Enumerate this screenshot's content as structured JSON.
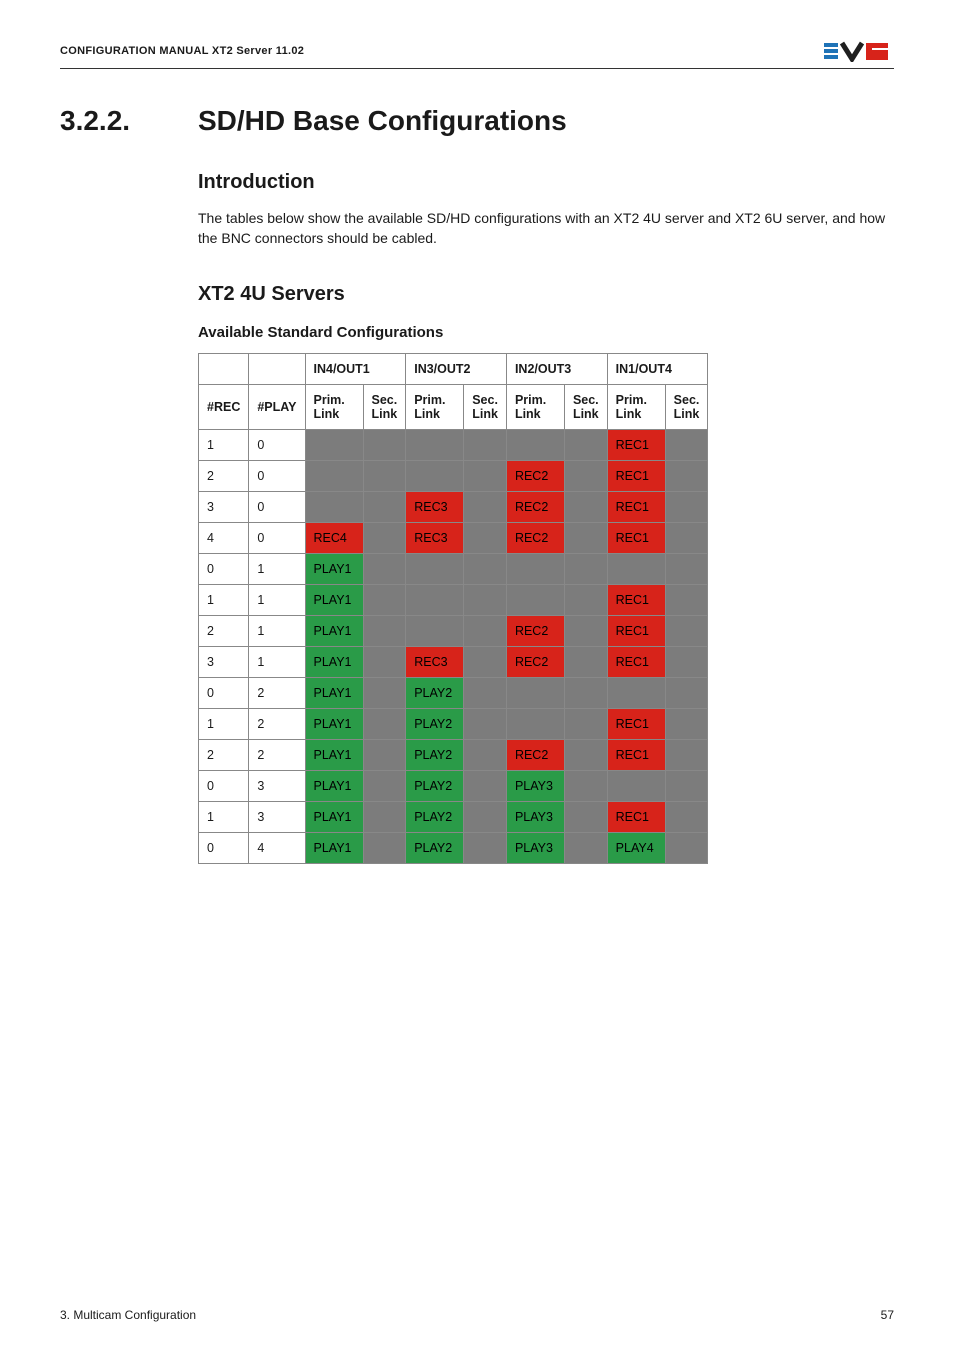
{
  "header": {
    "manual_title": "CONFIGURATION MANUAL XT2 Server 11.02"
  },
  "section": {
    "number": "3.2.2.",
    "title": "SD/HD Base Configurations"
  },
  "intro": {
    "heading": "Introduction",
    "text": "The tables below show the available SD/HD configurations with an XT2 4U server and XT2 6U server, and how the BNC connectors should be cabled."
  },
  "servers_heading": "XT2 4U Servers",
  "table_heading": "Available Standard Configurations",
  "columns": {
    "group_labels": [
      "IN4/OUT1",
      "IN3/OUT2",
      "IN2/OUT3",
      "IN1/OUT4"
    ],
    "rec": "#REC",
    "play": "#PLAY",
    "prim": "Prim. Link",
    "sec": "Sec. Link"
  },
  "chart_data": {
    "type": "table",
    "title": "Available Standard Configurations",
    "columns": [
      "#REC",
      "#PLAY",
      "IN4/OUT1 Prim. Link",
      "IN4/OUT1 Sec. Link",
      "IN3/OUT2 Prim. Link",
      "IN3/OUT2 Sec. Link",
      "IN2/OUT3 Prim. Link",
      "IN2/OUT3 Sec. Link",
      "IN1/OUT4 Prim. Link",
      "IN1/OUT4 Sec. Link"
    ],
    "rows": [
      {
        "rec": "1",
        "play": "0",
        "cells": [
          {
            "v": "",
            "t": "gray"
          },
          {
            "v": "",
            "t": "gray"
          },
          {
            "v": "",
            "t": "gray"
          },
          {
            "v": "",
            "t": "gray"
          },
          {
            "v": "",
            "t": "gray"
          },
          {
            "v": "",
            "t": "gray"
          },
          {
            "v": "REC1",
            "t": "rec"
          },
          {
            "v": "",
            "t": "gray"
          }
        ]
      },
      {
        "rec": "2",
        "play": "0",
        "cells": [
          {
            "v": "",
            "t": "gray"
          },
          {
            "v": "",
            "t": "gray"
          },
          {
            "v": "",
            "t": "gray"
          },
          {
            "v": "",
            "t": "gray"
          },
          {
            "v": "REC2",
            "t": "rec"
          },
          {
            "v": "",
            "t": "gray"
          },
          {
            "v": "REC1",
            "t": "rec"
          },
          {
            "v": "",
            "t": "gray"
          }
        ]
      },
      {
        "rec": "3",
        "play": "0",
        "cells": [
          {
            "v": "",
            "t": "gray"
          },
          {
            "v": "",
            "t": "gray"
          },
          {
            "v": "REC3",
            "t": "rec"
          },
          {
            "v": "",
            "t": "gray"
          },
          {
            "v": "REC2",
            "t": "rec"
          },
          {
            "v": "",
            "t": "gray"
          },
          {
            "v": "REC1",
            "t": "rec"
          },
          {
            "v": "",
            "t": "gray"
          }
        ]
      },
      {
        "rec": "4",
        "play": "0",
        "cells": [
          {
            "v": "REC4",
            "t": "rec"
          },
          {
            "v": "",
            "t": "gray"
          },
          {
            "v": "REC3",
            "t": "rec"
          },
          {
            "v": "",
            "t": "gray"
          },
          {
            "v": "REC2",
            "t": "rec"
          },
          {
            "v": "",
            "t": "gray"
          },
          {
            "v": "REC1",
            "t": "rec"
          },
          {
            "v": "",
            "t": "gray"
          }
        ]
      },
      {
        "rec": "0",
        "play": "1",
        "cells": [
          {
            "v": "PLAY1",
            "t": "play"
          },
          {
            "v": "",
            "t": "gray"
          },
          {
            "v": "",
            "t": "gray"
          },
          {
            "v": "",
            "t": "gray"
          },
          {
            "v": "",
            "t": "gray"
          },
          {
            "v": "",
            "t": "gray"
          },
          {
            "v": "",
            "t": "gray"
          },
          {
            "v": "",
            "t": "gray"
          }
        ]
      },
      {
        "rec": "1",
        "play": "1",
        "cells": [
          {
            "v": "PLAY1",
            "t": "play"
          },
          {
            "v": "",
            "t": "gray"
          },
          {
            "v": "",
            "t": "gray"
          },
          {
            "v": "",
            "t": "gray"
          },
          {
            "v": "",
            "t": "gray"
          },
          {
            "v": "",
            "t": "gray"
          },
          {
            "v": "REC1",
            "t": "rec"
          },
          {
            "v": "",
            "t": "gray"
          }
        ]
      },
      {
        "rec": "2",
        "play": "1",
        "cells": [
          {
            "v": "PLAY1",
            "t": "play"
          },
          {
            "v": "",
            "t": "gray"
          },
          {
            "v": "",
            "t": "gray"
          },
          {
            "v": "",
            "t": "gray"
          },
          {
            "v": "REC2",
            "t": "rec"
          },
          {
            "v": "",
            "t": "gray"
          },
          {
            "v": "REC1",
            "t": "rec"
          },
          {
            "v": "",
            "t": "gray"
          }
        ]
      },
      {
        "rec": "3",
        "play": "1",
        "cells": [
          {
            "v": "PLAY1",
            "t": "play"
          },
          {
            "v": "",
            "t": "gray"
          },
          {
            "v": "REC3",
            "t": "rec"
          },
          {
            "v": "",
            "t": "gray"
          },
          {
            "v": "REC2",
            "t": "rec"
          },
          {
            "v": "",
            "t": "gray"
          },
          {
            "v": "REC1",
            "t": "rec"
          },
          {
            "v": "",
            "t": "gray"
          }
        ]
      },
      {
        "rec": "0",
        "play": "2",
        "cells": [
          {
            "v": "PLAY1",
            "t": "play"
          },
          {
            "v": "",
            "t": "gray"
          },
          {
            "v": "PLAY2",
            "t": "play"
          },
          {
            "v": "",
            "t": "gray"
          },
          {
            "v": "",
            "t": "gray"
          },
          {
            "v": "",
            "t": "gray"
          },
          {
            "v": "",
            "t": "gray"
          },
          {
            "v": "",
            "t": "gray"
          }
        ]
      },
      {
        "rec": "1",
        "play": "2",
        "cells": [
          {
            "v": "PLAY1",
            "t": "play"
          },
          {
            "v": "",
            "t": "gray"
          },
          {
            "v": "PLAY2",
            "t": "play"
          },
          {
            "v": "",
            "t": "gray"
          },
          {
            "v": "",
            "t": "gray"
          },
          {
            "v": "",
            "t": "gray"
          },
          {
            "v": "REC1",
            "t": "rec"
          },
          {
            "v": "",
            "t": "gray"
          }
        ]
      },
      {
        "rec": "2",
        "play": "2",
        "cells": [
          {
            "v": "PLAY1",
            "t": "play"
          },
          {
            "v": "",
            "t": "gray"
          },
          {
            "v": "PLAY2",
            "t": "play"
          },
          {
            "v": "",
            "t": "gray"
          },
          {
            "v": "REC2",
            "t": "rec"
          },
          {
            "v": "",
            "t": "gray"
          },
          {
            "v": "REC1",
            "t": "rec"
          },
          {
            "v": "",
            "t": "gray"
          }
        ]
      },
      {
        "rec": "0",
        "play": "3",
        "cells": [
          {
            "v": "PLAY1",
            "t": "play"
          },
          {
            "v": "",
            "t": "gray"
          },
          {
            "v": "PLAY2",
            "t": "play"
          },
          {
            "v": "",
            "t": "gray"
          },
          {
            "v": "PLAY3",
            "t": "play"
          },
          {
            "v": "",
            "t": "gray"
          },
          {
            "v": "",
            "t": "gray"
          },
          {
            "v": "",
            "t": "gray"
          }
        ]
      },
      {
        "rec": "1",
        "play": "3",
        "cells": [
          {
            "v": "PLAY1",
            "t": "play"
          },
          {
            "v": "",
            "t": "gray"
          },
          {
            "v": "PLAY2",
            "t": "play"
          },
          {
            "v": "",
            "t": "gray"
          },
          {
            "v": "PLAY3",
            "t": "play"
          },
          {
            "v": "",
            "t": "gray"
          },
          {
            "v": "REC1",
            "t": "rec"
          },
          {
            "v": "",
            "t": "gray"
          }
        ]
      },
      {
        "rec": "0",
        "play": "4",
        "cells": [
          {
            "v": "PLAY1",
            "t": "play"
          },
          {
            "v": "",
            "t": "gray"
          },
          {
            "v": "PLAY2",
            "t": "play"
          },
          {
            "v": "",
            "t": "gray"
          },
          {
            "v": "PLAY3",
            "t": "play"
          },
          {
            "v": "",
            "t": "gray"
          },
          {
            "v": "PLAY4",
            "t": "play"
          },
          {
            "v": "",
            "t": "gray"
          }
        ]
      }
    ]
  },
  "footer": {
    "left": "3. Multicam Configuration",
    "right": "57"
  }
}
